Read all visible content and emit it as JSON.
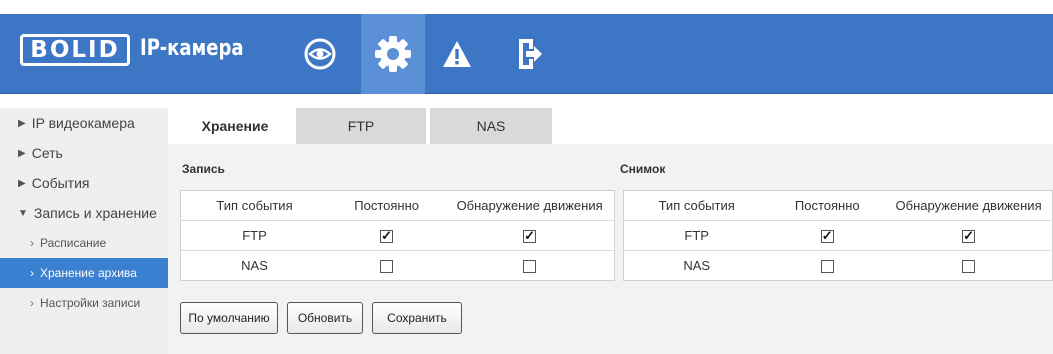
{
  "header": {
    "logo_text": "BOLID",
    "title": "IP-камера",
    "icons": [
      "eye-icon",
      "gear-icon",
      "warning-icon",
      "exit-icon"
    ],
    "active_icon": "gear-icon",
    "color": "#3c76c4"
  },
  "sidebar": {
    "items": [
      {
        "label": "IP видеокамера",
        "expanded": false
      },
      {
        "label": "Сеть",
        "expanded": false
      },
      {
        "label": "События",
        "expanded": false
      },
      {
        "label": "Запись и хранение",
        "expanded": true
      }
    ],
    "subitems": [
      {
        "label": "Расписание"
      },
      {
        "label": "Хранение архива",
        "active": true
      },
      {
        "label": "Настройки записи"
      }
    ],
    "active_color": "#3a7fd0"
  },
  "tabs": [
    {
      "label": "Хранение",
      "active": true
    },
    {
      "label": "FTP",
      "active": false
    },
    {
      "label": "NAS",
      "active": false
    }
  ],
  "record": {
    "title": "Запись",
    "columns": [
      "Тип события",
      "Постоянно",
      "Обнаружение движения"
    ],
    "rows": [
      {
        "type": "FTP",
        "constant": true,
        "motion": true
      },
      {
        "type": "NAS",
        "constant": false,
        "motion": false
      }
    ]
  },
  "snapshot": {
    "title": "Снимок",
    "columns": [
      "Тип события",
      "Постоянно",
      "Обнаружение движения"
    ],
    "rows": [
      {
        "type": "FTP",
        "constant": true,
        "motion": true
      },
      {
        "type": "NAS",
        "constant": false,
        "motion": false
      }
    ]
  },
  "buttons": {
    "default": "По умолчанию",
    "refresh": "Обновить",
    "save": "Сохранить"
  }
}
